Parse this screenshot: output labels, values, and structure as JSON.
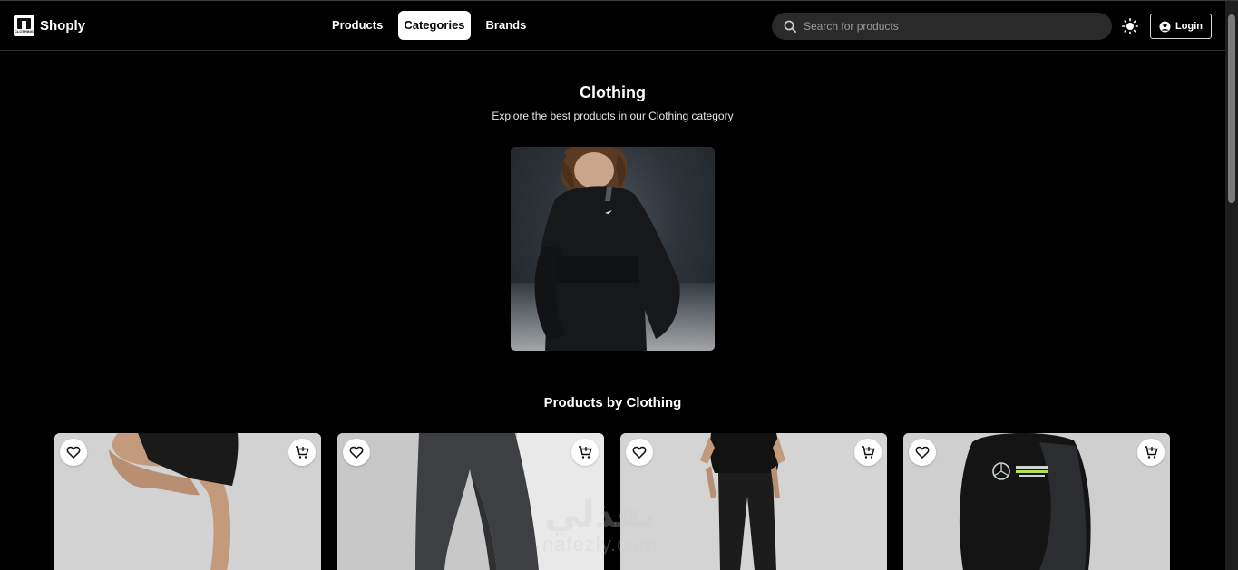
{
  "header": {
    "brand": "Shoply",
    "logo_caption": "CLOTHING",
    "nav": [
      {
        "label": "Products",
        "active": false
      },
      {
        "label": "Categories",
        "active": true
      },
      {
        "label": "Brands",
        "active": false
      }
    ],
    "search_placeholder": "Search for products",
    "login_label": "Login"
  },
  "hero": {
    "title": "Clothing",
    "subtitle": "Explore the best products in our Clothing category",
    "image_alt": "Person wearing black hooded jacket"
  },
  "products_section": {
    "title": "Products by Clothing",
    "items": [
      {
        "image": "black shorts"
      },
      {
        "image": "grey sweatpants"
      },
      {
        "image": "black t-shirt and trousers"
      },
      {
        "image": "black hoodie"
      }
    ]
  },
  "watermark": {
    "arabic": "نفذلي",
    "latin": "nafezly.com"
  },
  "colors": {
    "background": "#000000",
    "card_bg": "#d0d0d0",
    "search_bg": "#2a2a2a"
  }
}
